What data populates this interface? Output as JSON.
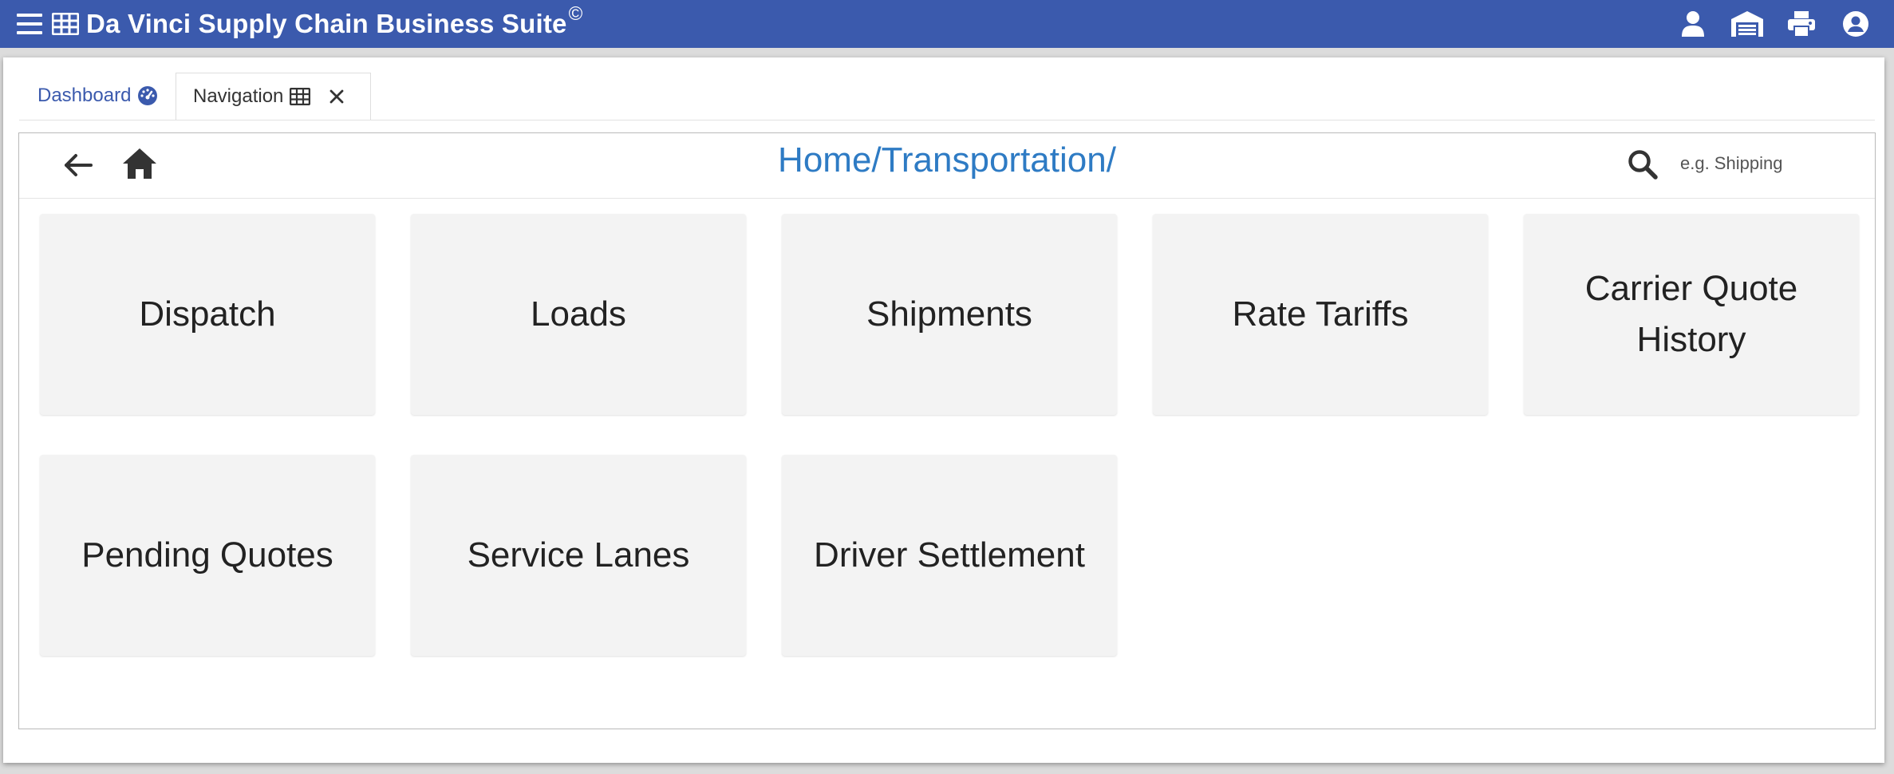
{
  "app": {
    "title": "Da Vinci Supply Chain Business Suite",
    "copyright_mark": "©"
  },
  "header_icons": [
    "menu-icon",
    "grid-icon",
    "user-icon",
    "warehouse-icon",
    "printer-icon",
    "account-circle-icon"
  ],
  "tabs": [
    {
      "label": "Dashboard",
      "icon": "dashboard-gauge-icon",
      "active": false
    },
    {
      "label": "Navigation",
      "icon": "grid-icon",
      "active": true,
      "closable": true
    }
  ],
  "toolbar": {
    "breadcrumb": "Home/Transportation/",
    "search": {
      "placeholder": "e.g. Shipping",
      "value": ""
    }
  },
  "tiles": [
    {
      "label": "Dispatch"
    },
    {
      "label": "Loads"
    },
    {
      "label": "Shipments"
    },
    {
      "label": "Rate Tariffs"
    },
    {
      "label": "Carrier Quote History"
    },
    {
      "label": "Pending Quotes"
    },
    {
      "label": "Service Lanes"
    },
    {
      "label": "Driver Settlement"
    }
  ],
  "colors": {
    "header_bg": "#3b5aad",
    "breadcrumb": "#2e7bc4",
    "tile_bg": "#f3f3f3",
    "active_tab_text": "#333333",
    "inactive_tab_text": "#3b5aad"
  }
}
